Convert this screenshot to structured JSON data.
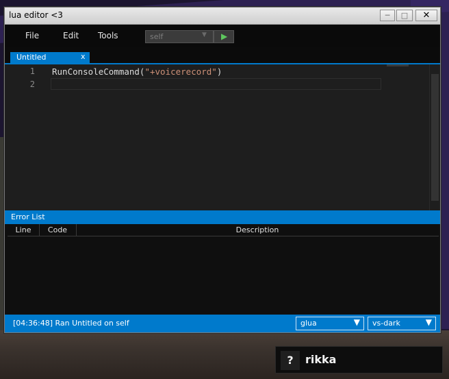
{
  "window": {
    "title": "lua editor <3",
    "controls": {
      "minimize": "─",
      "maximize": "□",
      "close": "✕"
    }
  },
  "menu": {
    "file": "File",
    "edit": "Edit",
    "tools": "Tools"
  },
  "toolbar": {
    "target_value": "self",
    "target_arrow_icon": "▼",
    "run_icon": "▶"
  },
  "tabs": [
    {
      "label": "Untitled",
      "close": "x"
    }
  ],
  "editor": {
    "lines": [
      {
        "number": "1",
        "fn": "RunConsoleCommand(",
        "str": "\"+voicerecord\"",
        "end": ")"
      },
      {
        "number": "2",
        "fn": "",
        "str": "",
        "end": ""
      }
    ]
  },
  "error_list": {
    "title": "Error List",
    "columns": [
      "Line",
      "Code",
      "Description"
    ]
  },
  "status": {
    "message": "[04:36:48] Ran Untitled on self",
    "language": "glua",
    "theme": "vs-dark",
    "arrow_icon": "▼"
  },
  "voice": {
    "icon": "?",
    "name": "rikka"
  },
  "colors": {
    "accent": "#007acc",
    "string": "#ce9178",
    "run": "#5ec75e"
  }
}
